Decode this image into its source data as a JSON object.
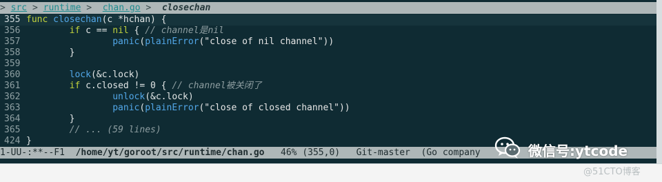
{
  "header": {
    "prefix": ">",
    "crumbs": [
      "src",
      "runtime",
      "chan.go"
    ],
    "separator": ">",
    "function": "closechan"
  },
  "code": [
    {
      "no": "355",
      "current": true
    },
    {
      "no": "356"
    },
    {
      "no": "357"
    },
    {
      "no": "358"
    },
    {
      "no": "359"
    },
    {
      "no": "360"
    },
    {
      "no": "361"
    },
    {
      "no": "362"
    },
    {
      "no": "363"
    },
    {
      "no": "364"
    },
    {
      "no": "365"
    },
    {
      "no": "424"
    }
  ],
  "tokens": {
    "l355_kw": "func",
    "l355_fn": "closechan",
    "l355_rest": "(c *hchan) {",
    "l356_kw": "if",
    "l356_mid": " c == ",
    "l356_kw2": "nil",
    "l356_brace": " { ",
    "l356_cm": "// channel是nil",
    "l357_fn": "panic",
    "l357_p1": "(",
    "l357_fn2": "plainError",
    "l357_str": "(\"close of nil channel\"))",
    "l358": "}",
    "l360_fn": "lock",
    "l360_rest": "(&c.lock)",
    "l361_kw": "if",
    "l361_mid": " c.closed != 0 { ",
    "l361_cm": "// channel被关闭了",
    "l362_fn": "unlock",
    "l362_rest": "(&c.lock)",
    "l363_fn": "panic",
    "l363_p1": "(",
    "l363_fn2": "plainError",
    "l363_str": "(\"close of closed channel\"))",
    "l364": "}",
    "l365_cm": "// ... (59 lines)",
    "l424": "}"
  },
  "modeline": {
    "status": "1-UU-:**--F1",
    "buffer": "/home/yt/goroot/src/runtime/chan.go",
    "percent": "46%",
    "position": "(355,0)",
    "vc": "Git-master",
    "mode": "(Go company"
  },
  "watermark": {
    "title": "微信号:ytcode",
    "sub": "@51CTO博客",
    "logo_icon": "wechat-logo-icon"
  },
  "colors": {
    "background": "#0f2b33",
    "keyword": "#c2d33c",
    "function": "#52a7e8",
    "comment": "#8e9ea1",
    "bar": "#aeb7b8"
  }
}
